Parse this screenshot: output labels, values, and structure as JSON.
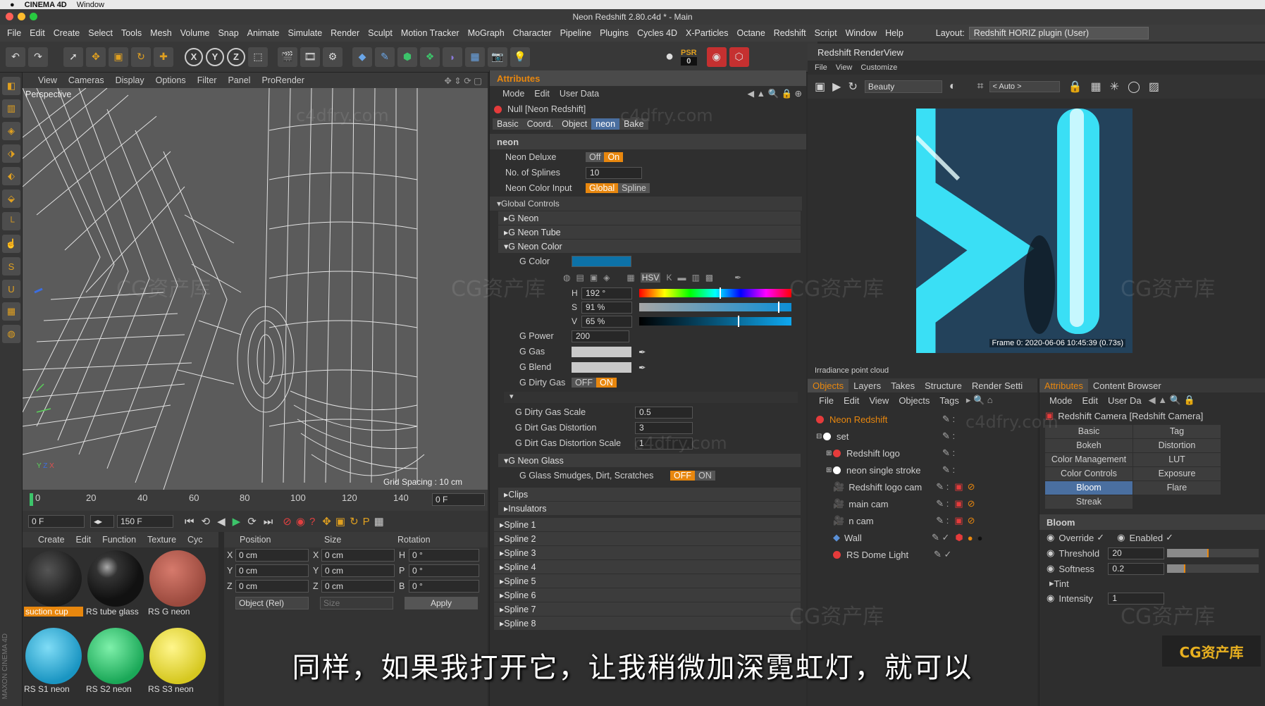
{
  "mac_menu": {
    "apple": "",
    "app": "CINEMA 4D",
    "window": "Window"
  },
  "window_title": "Neon Redshift 2.80.c4d * - Main",
  "menu": [
    "File",
    "Edit",
    "Create",
    "Select",
    "Tools",
    "Mesh",
    "Volume",
    "Snap",
    "Animate",
    "Simulate",
    "Render",
    "Sculpt",
    "Motion Tracker",
    "MoGraph",
    "Character",
    "Pipeline",
    "Plugins",
    "Cycles 4D",
    "X-Particles",
    "Octane",
    "Redshift",
    "Script",
    "Window",
    "Help"
  ],
  "layout_label": "Layout:",
  "layout_value": "Redshift HORIZ plugin (User)",
  "toolbar": {
    "axes": [
      "X",
      "Y",
      "Z"
    ],
    "psr_label": "PSR",
    "psr_value": "0"
  },
  "viewport": {
    "menu": [
      "View",
      "Cameras",
      "Display",
      "Options",
      "Filter",
      "Panel",
      "ProRender"
    ],
    "label": "Perspective",
    "grid_spacing": "Grid Spacing : 10 cm"
  },
  "timeline": {
    "ticks": [
      "0",
      "20",
      "40",
      "60",
      "80",
      "100",
      "120",
      "140"
    ],
    "end": "0 F"
  },
  "transport": {
    "current": "0 F",
    "end": "150 F"
  },
  "materials": {
    "menu": [
      "Create",
      "Edit",
      "Function",
      "Texture",
      "Cyc"
    ],
    "items": [
      {
        "name": "suction cup",
        "color": "#222222"
      },
      {
        "name": "RS tube glass",
        "color": "#1a1a1a"
      },
      {
        "name": "RS G neon",
        "color": "#b85a4e"
      },
      {
        "name": "RS S1 neon",
        "color": "#2aaed6"
      },
      {
        "name": "RS S2 neon",
        "color": "#22c46a"
      },
      {
        "name": "RS S3 neon",
        "color": "#e6de3a"
      }
    ]
  },
  "coords": {
    "headers": [
      "Position",
      "Size",
      "Rotation"
    ],
    "rows": [
      {
        "a": "X",
        "av": "0 cm",
        "b": "X",
        "bv": "0 cm",
        "c": "H",
        "cv": "0 °"
      },
      {
        "a": "Y",
        "av": "0 cm",
        "b": "Y",
        "bv": "0 cm",
        "c": "P",
        "cv": "0 °"
      },
      {
        "a": "Z",
        "av": "0 cm",
        "b": "Z",
        "bv": "0 cm",
        "c": "B",
        "cv": "0 °"
      }
    ],
    "mode": "Object (Rel)",
    "size_mode": "Size",
    "apply": "Apply"
  },
  "attributes": {
    "title": "Attributes",
    "menu": [
      "Mode",
      "Edit",
      "User Data"
    ],
    "object": "Null [Neon Redshift]",
    "tabs": [
      "Basic",
      "Coord.",
      "Object",
      "neon",
      "Bake"
    ],
    "active_tab": "neon",
    "section": "neon",
    "neon_deluxe": {
      "label": "Neon Deluxe",
      "off": "Off",
      "on": "On"
    },
    "splines": {
      "label": "No. of Splines",
      "value": "10"
    },
    "color_input": {
      "label": "Neon Color Input",
      "a": "Global",
      "b": "Spline"
    },
    "global_controls": "Global Controls",
    "groups": [
      "G Neon",
      "G Neon Tube",
      "G Neon Color"
    ],
    "g_color": {
      "label": "G Color",
      "swatch": "#0d72a8"
    },
    "hsv": {
      "h_label": "H",
      "h": "192 °",
      "h_frac": 0.53,
      "s_label": "S",
      "s": "91 %",
      "s_frac": 0.91,
      "v_label": "V",
      "v": "65 %",
      "v_frac": 0.65
    },
    "g_power": {
      "label": "G Power",
      "value": "200"
    },
    "g_gas": "G Gas",
    "g_blend": "G Blend",
    "g_dirty_gas": {
      "label": "G Dirty Gas",
      "off": "OFF",
      "on": "ON"
    },
    "dirty": [
      {
        "label": "G Dirty Gas Scale",
        "value": "0.5"
      },
      {
        "label": "G Dirt Gas Distortion",
        "value": "3"
      },
      {
        "label": "G Dirt Gas Distortion Scale",
        "value": "1"
      }
    ],
    "g_neon_glass": "G Neon Glass",
    "smudges": {
      "label": "G Glass Smudges, Dirt, Scratches",
      "off": "OFF",
      "on": "ON"
    },
    "other_groups": [
      "Clips",
      "Insulators"
    ],
    "splines_list": [
      "Spline 1",
      "Spline 2",
      "Spline 3",
      "Spline 4",
      "Spline 5",
      "Spline 6",
      "Spline 7",
      "Spline 8"
    ]
  },
  "renderview": {
    "title": "Redshift RenderView",
    "menu": [
      "File",
      "View",
      "Customize"
    ],
    "aov": "Beauty",
    "camera": "< Auto >",
    "frame_info": "Frame 0: 2020-06-06 10:45:39 (0.73s)",
    "status": "Irradiance point cloud"
  },
  "objects": {
    "tabs": [
      "Objects",
      "Layers",
      "Takes",
      "Structure",
      "Render Setti"
    ],
    "menu": [
      "File",
      "Edit",
      "View",
      "Objects",
      "Tags"
    ],
    "items": [
      {
        "name": "Neon Redshift",
        "color": "#e53b3b",
        "indent": 0,
        "highlight": true
      },
      {
        "name": "set",
        "color": "#ffffff",
        "indent": 0,
        "highlight": false
      },
      {
        "name": "Redshift logo",
        "color": "#e53b3b",
        "indent": 1,
        "highlight": false
      },
      {
        "name": "neon single stroke",
        "color": "#ffffff",
        "indent": 1,
        "highlight": false
      },
      {
        "name": "Redshift logo cam",
        "color": "#cccccc",
        "indent": 1,
        "highlight": false
      },
      {
        "name": "main cam",
        "color": "#cccccc",
        "indent": 1,
        "highlight": false
      },
      {
        "name": "n cam",
        "color": "#cccccc",
        "indent": 1,
        "highlight": false
      },
      {
        "name": "Wall",
        "color": "#5a8fd6",
        "indent": 1,
        "highlight": false
      },
      {
        "name": "RS Dome Light",
        "color": "#e53b3b",
        "indent": 1,
        "highlight": false
      }
    ]
  },
  "cam_attr": {
    "tabs": [
      "Attributes",
      "Content Browser"
    ],
    "menu": [
      "Mode",
      "Edit",
      "User Da"
    ],
    "object": "Redshift Camera [Redshift Camera]",
    "grid": [
      "Basic",
      "Tag",
      "Bokeh",
      "Distortion",
      "Color Management",
      "LUT",
      "Color Controls",
      "Exposure",
      "Bloom",
      "Flare",
      "Streak"
    ],
    "active": "Bloom",
    "section": "Bloom",
    "override": "Override",
    "enabled": "Enabled",
    "threshold": {
      "label": "Threshold",
      "value": "20",
      "frac": 0.45
    },
    "softness": {
      "label": "Softness",
      "value": "0.2",
      "frac": 0.2
    },
    "tint": "Tint",
    "intensity": {
      "label": "Intensity",
      "value": "1"
    }
  },
  "subtitle": "同样，如果我打开它，让我稍微加深霓虹灯，就可以",
  "watermarks": {
    "cg": "CG资产库",
    "site": "c4dfry.com"
  },
  "logo": "CG资产库"
}
